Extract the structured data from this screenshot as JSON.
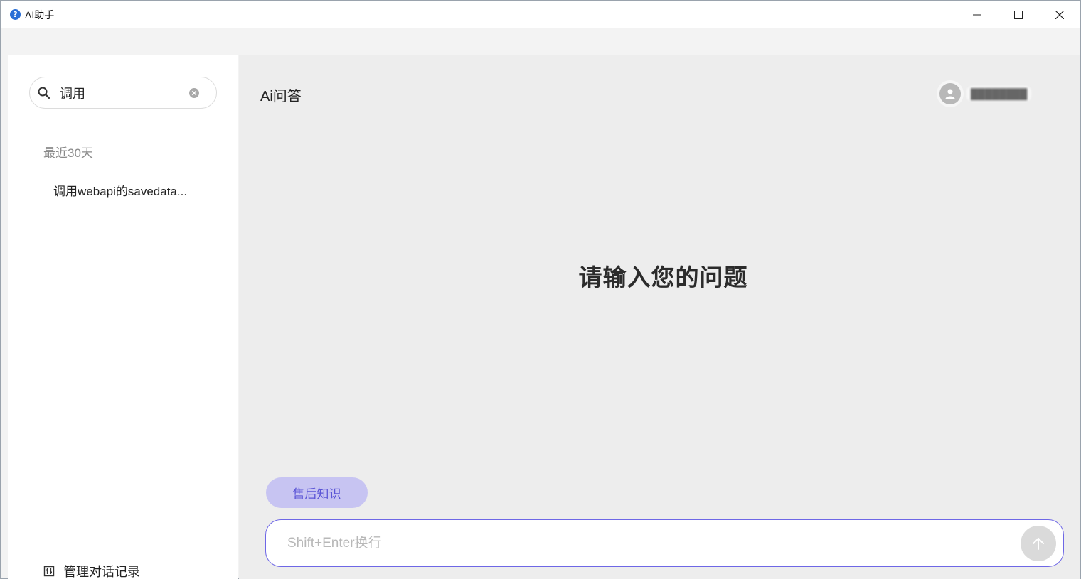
{
  "window": {
    "title": "AI助手",
    "app_icon_glyph": "?",
    "icons": {
      "minimize": "minimize-icon",
      "maximize": "maximize-icon",
      "close": "close-icon"
    }
  },
  "sidebar": {
    "search": {
      "value": "调用",
      "icon": "search-icon",
      "clear_icon": "clear-circle-icon"
    },
    "section_label": "最近30天",
    "history": [
      {
        "label": "调用webapi的savedata..."
      }
    ],
    "manage_label": "管理对话记录",
    "manage_icon": "manage-records-icon"
  },
  "main": {
    "title": "Ai问答",
    "headline": "请输入您的问题",
    "chip_label": "售后知识",
    "input_placeholder": "Shift+Enter换行",
    "send_icon": "arrow-up-icon"
  },
  "colors": {
    "accent": "#6e67e6",
    "chip_bg": "#c7c4f2",
    "chip_text": "#5b55d6",
    "main_bg": "#ededed",
    "send_button_bg": "#dadada"
  }
}
